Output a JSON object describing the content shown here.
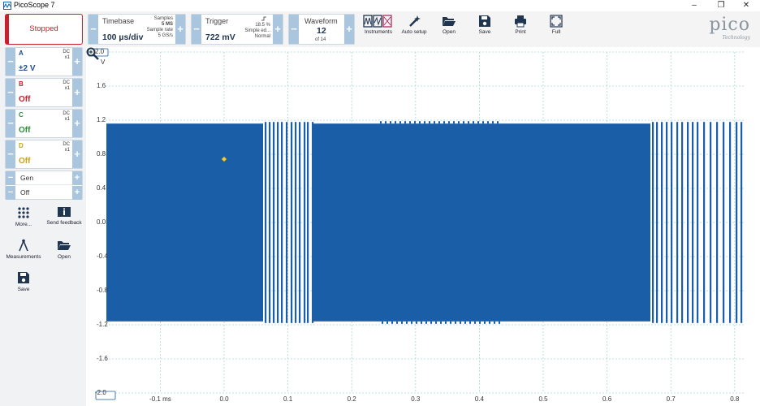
{
  "window": {
    "title": "PicoScope 7",
    "controls": [
      "–",
      "❐",
      "✕"
    ]
  },
  "toolbar": {
    "run_state": "Stopped",
    "timebase": {
      "label": "Timebase",
      "value": "100 µs/div",
      "samples_label": "Samples",
      "samples_value": "5 MS",
      "rate_label": "Sample rate",
      "rate_value": "5 GS/s"
    },
    "trigger": {
      "label": "Trigger",
      "value": "722 mV",
      "percent": "18.5 %",
      "mode": "Simple ed...",
      "type": "Normal"
    },
    "waveform": {
      "label": "Waveform",
      "value": "12",
      "of": "of 14"
    },
    "buttons": [
      "Instruments",
      "Auto setup",
      "Open",
      "Save",
      "Print",
      "Full"
    ],
    "logo": {
      "brand": "pico",
      "sub": "Technology"
    },
    "minus": "−",
    "plus": "+"
  },
  "sidebar": {
    "channels": [
      {
        "name": "A",
        "coupling": "DC",
        "probe": "x1",
        "value": "±2 V",
        "color": "#1f4e8c"
      },
      {
        "name": "B",
        "coupling": "DC",
        "probe": "x1",
        "value": "Off",
        "color": "#c8202c"
      },
      {
        "name": "C",
        "coupling": "DC",
        "probe": "x1",
        "value": "Off",
        "color": "#2e8b3a"
      },
      {
        "name": "D",
        "coupling": "DC",
        "probe": "x1",
        "value": "Off",
        "color": "#c9a21a"
      }
    ],
    "gen": {
      "label": "Gen",
      "value": "Off"
    },
    "buttons": [
      "More...",
      "Send feedback",
      "Measurements",
      "Open",
      "Save"
    ]
  },
  "scope": {
    "y_unit": "V",
    "y_ticks": [
      "2.0",
      "1.6",
      "1.2",
      "0.8",
      "0.4",
      "0.0",
      "-0.4",
      "-0.8",
      "-1.2",
      "-1.6",
      "-2.0"
    ],
    "x_ticks": [
      "-0.1 ms",
      "0.0",
      "0.1",
      "0.2",
      "0.3",
      "0.4",
      "0.5",
      "0.6",
      "0.7",
      "0.8"
    ],
    "trace_color": "#1a5ea8",
    "grid_color": "#a9d6d6"
  }
}
